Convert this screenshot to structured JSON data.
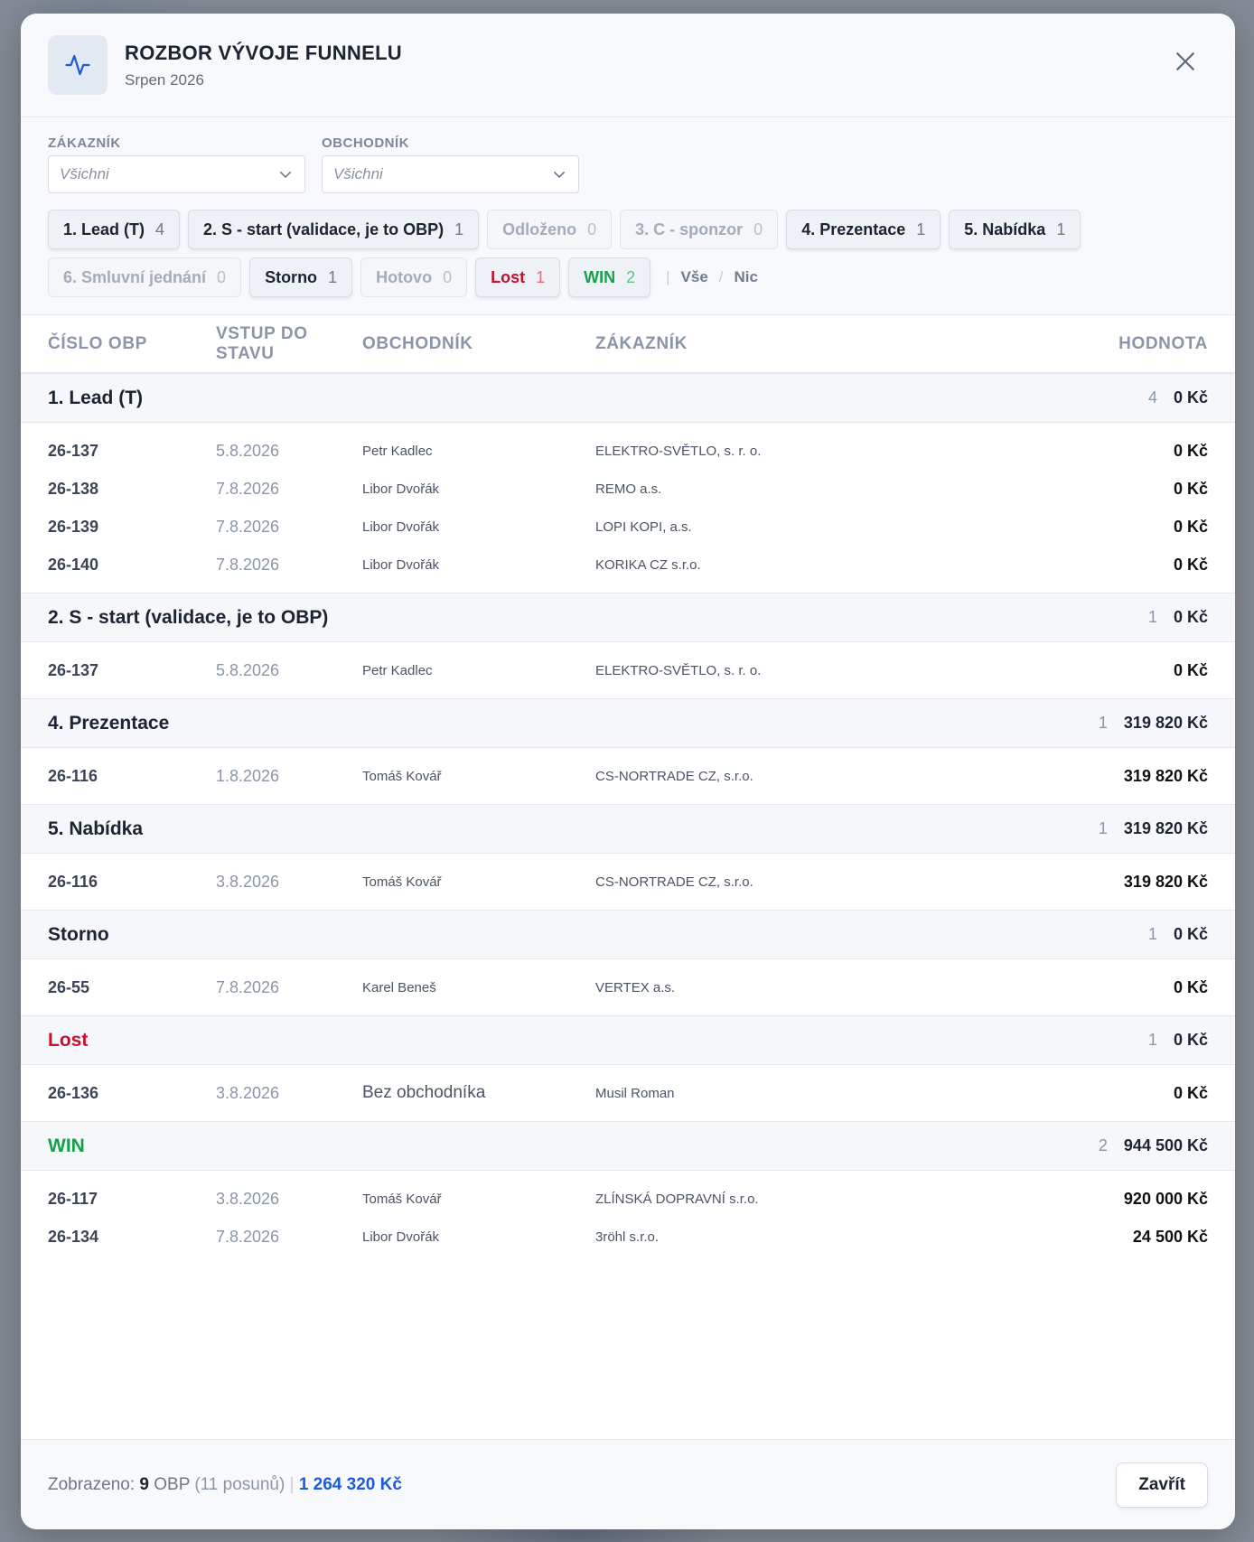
{
  "header": {
    "title": "ROZBOR VÝVOJE FUNNELU",
    "subtitle": "Srpen 2026",
    "icon": "activity-pulse-icon"
  },
  "filters": {
    "customer": {
      "label": "ZÁKAZNÍK",
      "value": "Všichni"
    },
    "salesperson": {
      "label": "OBCHODNÍK",
      "value": "Všichni"
    }
  },
  "chips": [
    {
      "label": "1. Lead (T)",
      "count": "4",
      "state": "on"
    },
    {
      "label": "2. S - start (validace, je to OBP)",
      "count": "1",
      "state": "on"
    },
    {
      "label": "Odloženo",
      "count": "0",
      "state": "off"
    },
    {
      "label": "3. C - sponzor",
      "count": "0",
      "state": "off"
    },
    {
      "label": "4. Prezentace",
      "count": "1",
      "state": "on"
    },
    {
      "label": "5. Nabídka",
      "count": "1",
      "state": "on"
    },
    {
      "label": "6. Smluvní jednání",
      "count": "0",
      "state": "off"
    },
    {
      "label": "Storno",
      "count": "1",
      "state": "on"
    },
    {
      "label": "Hotovo",
      "count": "0",
      "state": "off"
    },
    {
      "label": "Lost",
      "count": "1",
      "state": "lost"
    },
    {
      "label": "WIN",
      "count": "2",
      "state": "win"
    }
  ],
  "chip_links": {
    "all": "Vše",
    "none": "Nic",
    "divider": "|",
    "slash": "/"
  },
  "columns": {
    "number": "ČÍSLO OBP",
    "entry": "VSTUP DO STAVU",
    "salesperson": "OBCHODNÍK",
    "customer": "ZÁKAZNÍK",
    "value": "HODNOTA"
  },
  "groups": [
    {
      "name": "1. Lead (T)",
      "variant": "",
      "count": "4",
      "total": "0 Kč",
      "rows": [
        {
          "number": "26-137",
          "date": "5.8.2026",
          "salesperson": "Petr Kadlec",
          "customer": "ELEKTRO-SVĚTLO, s. r. o.",
          "value": "0 Kč"
        },
        {
          "number": "26-138",
          "date": "7.8.2026",
          "salesperson": "Libor Dvořák",
          "customer": "REMO a.s.",
          "value": "0 Kč"
        },
        {
          "number": "26-139",
          "date": "7.8.2026",
          "salesperson": "Libor Dvořák",
          "customer": "LOPI KOPI, a.s.",
          "value": "0 Kč"
        },
        {
          "number": "26-140",
          "date": "7.8.2026",
          "salesperson": "Libor Dvořák",
          "customer": "KORIKA CZ s.r.o.",
          "value": "0 Kč"
        }
      ]
    },
    {
      "name": "2. S - start (validace, je to OBP)",
      "variant": "",
      "count": "1",
      "total": "0 Kč",
      "rows": [
        {
          "number": "26-137",
          "date": "5.8.2026",
          "salesperson": "Petr Kadlec",
          "customer": "ELEKTRO-SVĚTLO, s. r. o.",
          "value": "0 Kč"
        }
      ]
    },
    {
      "name": "4. Prezentace",
      "variant": "",
      "count": "1",
      "total": "319 820 Kč",
      "rows": [
        {
          "number": "26-116",
          "date": "1.8.2026",
          "salesperson": "Tomáš Kovář",
          "customer": "CS-NORTRADE CZ, s.r.o.",
          "value": "319 820 Kč"
        }
      ]
    },
    {
      "name": "5. Nabídka",
      "variant": "",
      "count": "1",
      "total": "319 820 Kč",
      "rows": [
        {
          "number": "26-116",
          "date": "3.8.2026",
          "salesperson": "Tomáš Kovář",
          "customer": "CS-NORTRADE CZ, s.r.o.",
          "value": "319 820 Kč"
        }
      ]
    },
    {
      "name": "Storno",
      "variant": "",
      "count": "1",
      "total": "0 Kč",
      "rows": [
        {
          "number": "26-55",
          "date": "7.8.2026",
          "salesperson": "Karel Beneš",
          "customer": "VERTEX a.s.",
          "value": "0 Kč"
        }
      ]
    },
    {
      "name": "Lost",
      "variant": "lost",
      "count": "1",
      "total": "0 Kč",
      "rows": [
        {
          "number": "26-136",
          "date": "3.8.2026",
          "salesperson": "Bez obchodníka",
          "customer": "Musil Roman",
          "value": "0 Kč",
          "big": true
        }
      ]
    },
    {
      "name": "WIN",
      "variant": "win",
      "count": "2",
      "total": "944 500 Kč",
      "rows": [
        {
          "number": "26-117",
          "date": "3.8.2026",
          "salesperson": "Tomáš Kovář",
          "customer": "ZLÍNSKÁ DOPRAVNÍ s.r.o.",
          "value": "920 000 Kč"
        },
        {
          "number": "26-134",
          "date": "7.8.2026",
          "salesperson": "Libor Dvořák",
          "customer": "3röhl s.r.o.",
          "value": "24 500 Kč"
        }
      ]
    }
  ],
  "footer": {
    "shown_label": "Zobrazeno:",
    "shown_count": "9",
    "unit": "OBP",
    "moves": "(11 posunů)",
    "pipe": "|",
    "total": "1 264 320 Kč",
    "close_label": "Zavřít"
  },
  "colors": {
    "accent": "#1d5bd8",
    "lost": "#c8102e",
    "win": "#15a04a"
  }
}
